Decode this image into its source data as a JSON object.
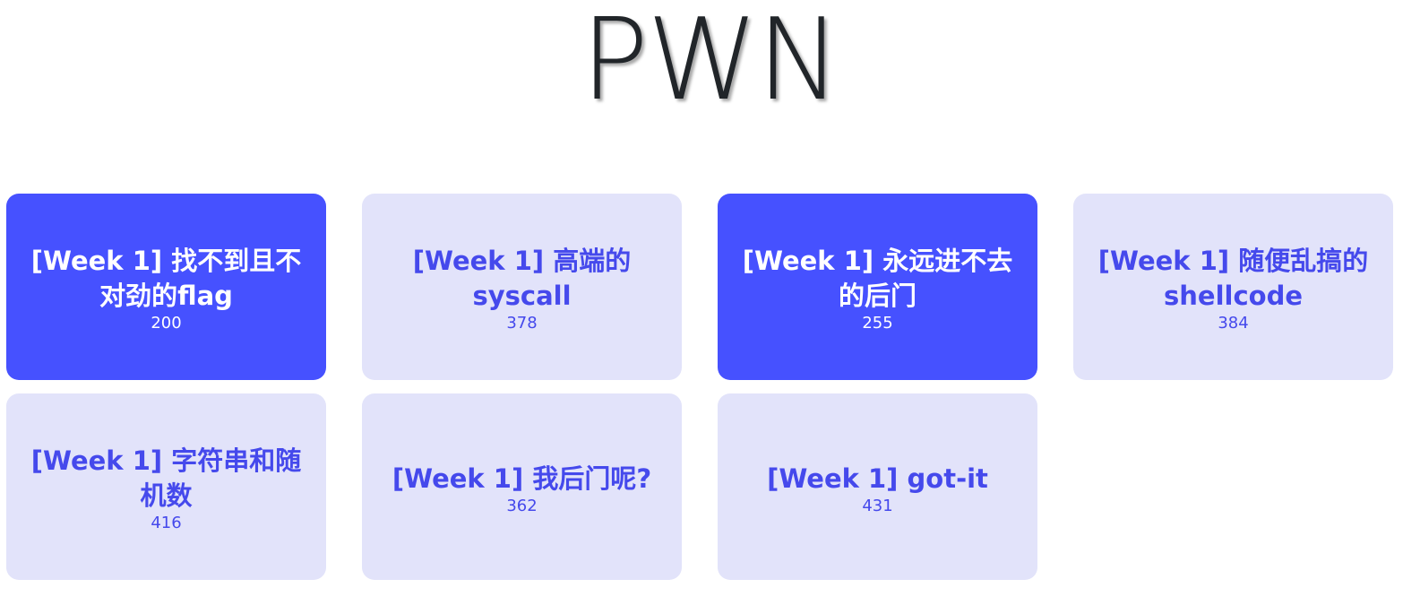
{
  "header": {
    "title": "PWN"
  },
  "challenges": [
    {
      "title": "[Week 1] 找不到且不对劲的flag",
      "points": "200",
      "solved": true
    },
    {
      "title": "[Week 1] 高端的syscall",
      "points": "378",
      "solved": false
    },
    {
      "title": "[Week 1] 永远进不去的后门",
      "points": "255",
      "solved": true
    },
    {
      "title": "[Week 1] 随便乱搞的shellcode",
      "points": "384",
      "solved": false
    },
    {
      "title": "[Week 1] 字符串和随机数",
      "points": "416",
      "solved": false
    },
    {
      "title": "[Week 1] 我后门呢?",
      "points": "362",
      "solved": false
    },
    {
      "title": "[Week 1] got-it",
      "points": "431",
      "solved": false
    }
  ],
  "colors": {
    "solved_bg": "#4651ff",
    "solved_text": "#ffffff",
    "unsolved_bg": "#e2e3fa",
    "unsolved_text": "#4549ec"
  }
}
